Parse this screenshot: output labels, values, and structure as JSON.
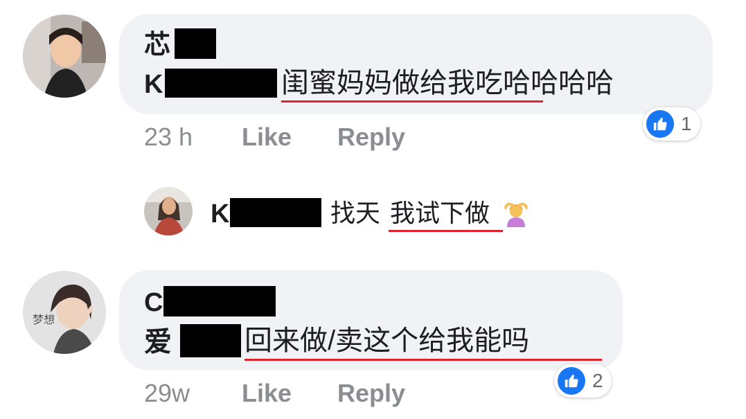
{
  "comments": [
    {
      "author_visible": "芯",
      "line_prefix": "K",
      "text": "闺蜜妈妈做给我吃哈哈哈哈",
      "time": "23 h",
      "like_label": "Like",
      "reply_label": "Reply",
      "reaction": {
        "icon": "like-icon",
        "count": "1"
      }
    },
    {
      "author_visible": "C",
      "line_prefix": "爱",
      "text": "回来做/卖这个给我能吗",
      "time": "29w",
      "like_label": "Like",
      "reply_label": "Reply",
      "reaction": {
        "icon": "like-icon",
        "count": "2"
      }
    }
  ],
  "reply": {
    "author_visible": "K",
    "text_a": "找天",
    "text_b": "我试下做",
    "emoji": "person-gesturing-ok-emoji"
  },
  "colors": {
    "bubble": "#f0f2f5",
    "underline": "#e0212e",
    "like_blue": "#1877f2",
    "meta_grey": "#8a8d91"
  }
}
